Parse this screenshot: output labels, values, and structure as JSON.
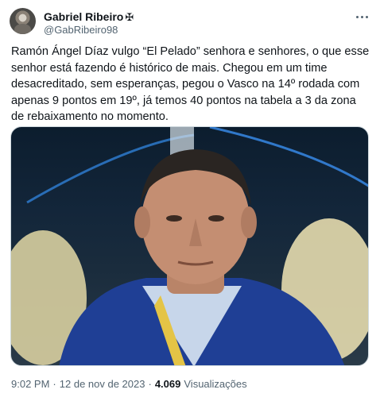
{
  "author": {
    "display_name": "Gabriel Ribeiro",
    "name_symbol": "✠",
    "handle": "@GabRibeiro98"
  },
  "tweet": {
    "text": "Ramón Ángel Díaz vulgo “El Pelado” senhora e senhores, o que esse senhor está fazendo é histórico de mais. Chegou em um time desacreditado, sem esperanças, pegou o Vasco na 14º rodada com apenas 9 pontos em 19º, já temos 40 pontos na tabela a 3 da zona de rebaixamento no momento.",
    "time": "9:02 PM",
    "date": "12 de nov de 2023",
    "views_count": "4.069",
    "views_label": "Visualizações"
  },
  "icons": {
    "more": "more-horizontal-icon"
  },
  "colors": {
    "text_primary": "#0f1419",
    "text_secondary": "#536471",
    "border": "#cfd9de"
  }
}
